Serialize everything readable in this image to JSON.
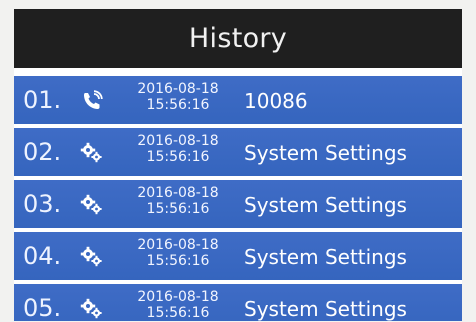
{
  "header": {
    "title": "History"
  },
  "colors": {
    "header_bg": "#1f1f1f",
    "row_bg": "#3a68c2",
    "text": "#ffffff"
  },
  "history": [
    {
      "index": "01.",
      "icon": "phone-icon",
      "date": "2016-08-18",
      "time": "15:56:16",
      "label": "10086"
    },
    {
      "index": "02.",
      "icon": "gear-icon",
      "date": "2016-08-18",
      "time": "15:56:16",
      "label": "System Settings"
    },
    {
      "index": "03.",
      "icon": "gear-icon",
      "date": "2016-08-18",
      "time": "15:56:16",
      "label": "System Settings"
    },
    {
      "index": "04.",
      "icon": "gear-icon",
      "date": "2016-08-18",
      "time": "15:56:16",
      "label": "System Settings"
    },
    {
      "index": "05.",
      "icon": "gear-icon",
      "date": "2016-08-18",
      "time": "15:56:16",
      "label": "System Settings"
    }
  ]
}
